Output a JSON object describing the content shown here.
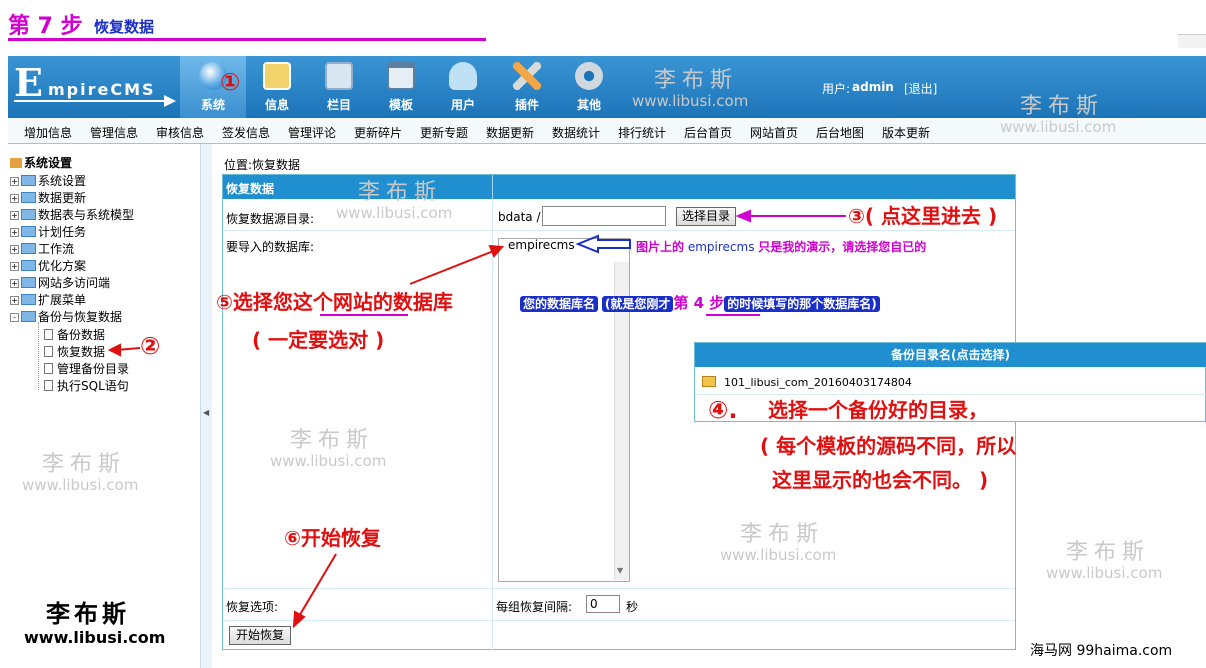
{
  "step": {
    "title": "第 7 步",
    "subtitle": "恢复数据"
  },
  "logo": {
    "big": "E",
    "small": "mpireCMS"
  },
  "nav": [
    {
      "label": "系统",
      "icon": "globe-icon",
      "color": "#5aa9e6"
    },
    {
      "label": "信息",
      "icon": "notepad-icon",
      "color": "#f2d36b"
    },
    {
      "label": "栏目",
      "icon": "folder-icon",
      "color": "#d9e6f2"
    },
    {
      "label": "模板",
      "icon": "window-icon",
      "color": "#e6eef5"
    },
    {
      "label": "用户",
      "icon": "user-icon",
      "color": "#bfe0f5"
    },
    {
      "label": "插件",
      "icon": "tools-icon",
      "color": "#f0a64a"
    },
    {
      "label": "其他",
      "icon": "gear-icon",
      "color": "#cfd8de"
    }
  ],
  "user": {
    "label": "用户:",
    "name": "admin",
    "logout": "[退出]"
  },
  "submenu": [
    "增加信息",
    "管理信息",
    "审核信息",
    "签发信息",
    "管理评论",
    "更新碎片",
    "更新专题",
    "数据更新",
    "数据统计",
    "排行统计",
    "后台首页",
    "网站首页",
    "后台地图",
    "版本更新"
  ],
  "tree": {
    "root": "系统设置",
    "items": [
      "系统设置",
      "数据更新",
      "数据表与系统模型",
      "计划任务",
      "工作流",
      "优化方案",
      "网站多访问端",
      "扩展菜单",
      "备份与恢复数据"
    ],
    "leaves": [
      "备份数据",
      "恢复数据",
      "管理备份目录",
      "执行SQL语句"
    ]
  },
  "form": {
    "location": "位置:恢复数据",
    "header": "恢复数据",
    "source_dir_label": "恢复数据源目录:",
    "bdata_prefix": "bdata /",
    "source_dir_value": "",
    "select_dir_button": "选择目录",
    "db_label": "要导入的数据库:",
    "db_item": "empirecms",
    "options_label": "恢复选项:",
    "interval_label": "每组恢复间隔:",
    "interval_value": "0",
    "interval_unit": "秒",
    "start_button": "开始恢复"
  },
  "backup": {
    "header": "备份目录名(点击选择)",
    "item": "101_libusi_com_20160403174804"
  },
  "annotations": {
    "a1": "①",
    "a2": "②",
    "a3": "③( 点这里进去 )",
    "a4_num": "④.",
    "a4_text": "选择一个备份好的目录，",
    "a4_note1": "( 每个模板的源码不同，所以",
    "a4_note2": "这里显示的也会不同。 )",
    "a5": "⑤选择您这个网站的数据库",
    "a5_note": "( 一定要选对 )",
    "a6": "⑥开始恢复",
    "demo_note_pre": "图片上的",
    "demo_note_db": "empirecms",
    "demo_note_post": "只是我的演示，请选择您自已的",
    "dbname_pre": "您的数据库名",
    "dbname_mid": "(就是您刚才",
    "dbname_step": "第 4 步",
    "dbname_post": "的时候填写的那个数据库名)"
  },
  "watermark": {
    "cn": "李布斯",
    "en": "www.libusi.com"
  },
  "credit": "海马网 99haima.com",
  "colors": {
    "accent": "#d000d0",
    "annotation": "#e01010",
    "banner": "#1c74b8",
    "panel_head": "#1f8fcf"
  }
}
